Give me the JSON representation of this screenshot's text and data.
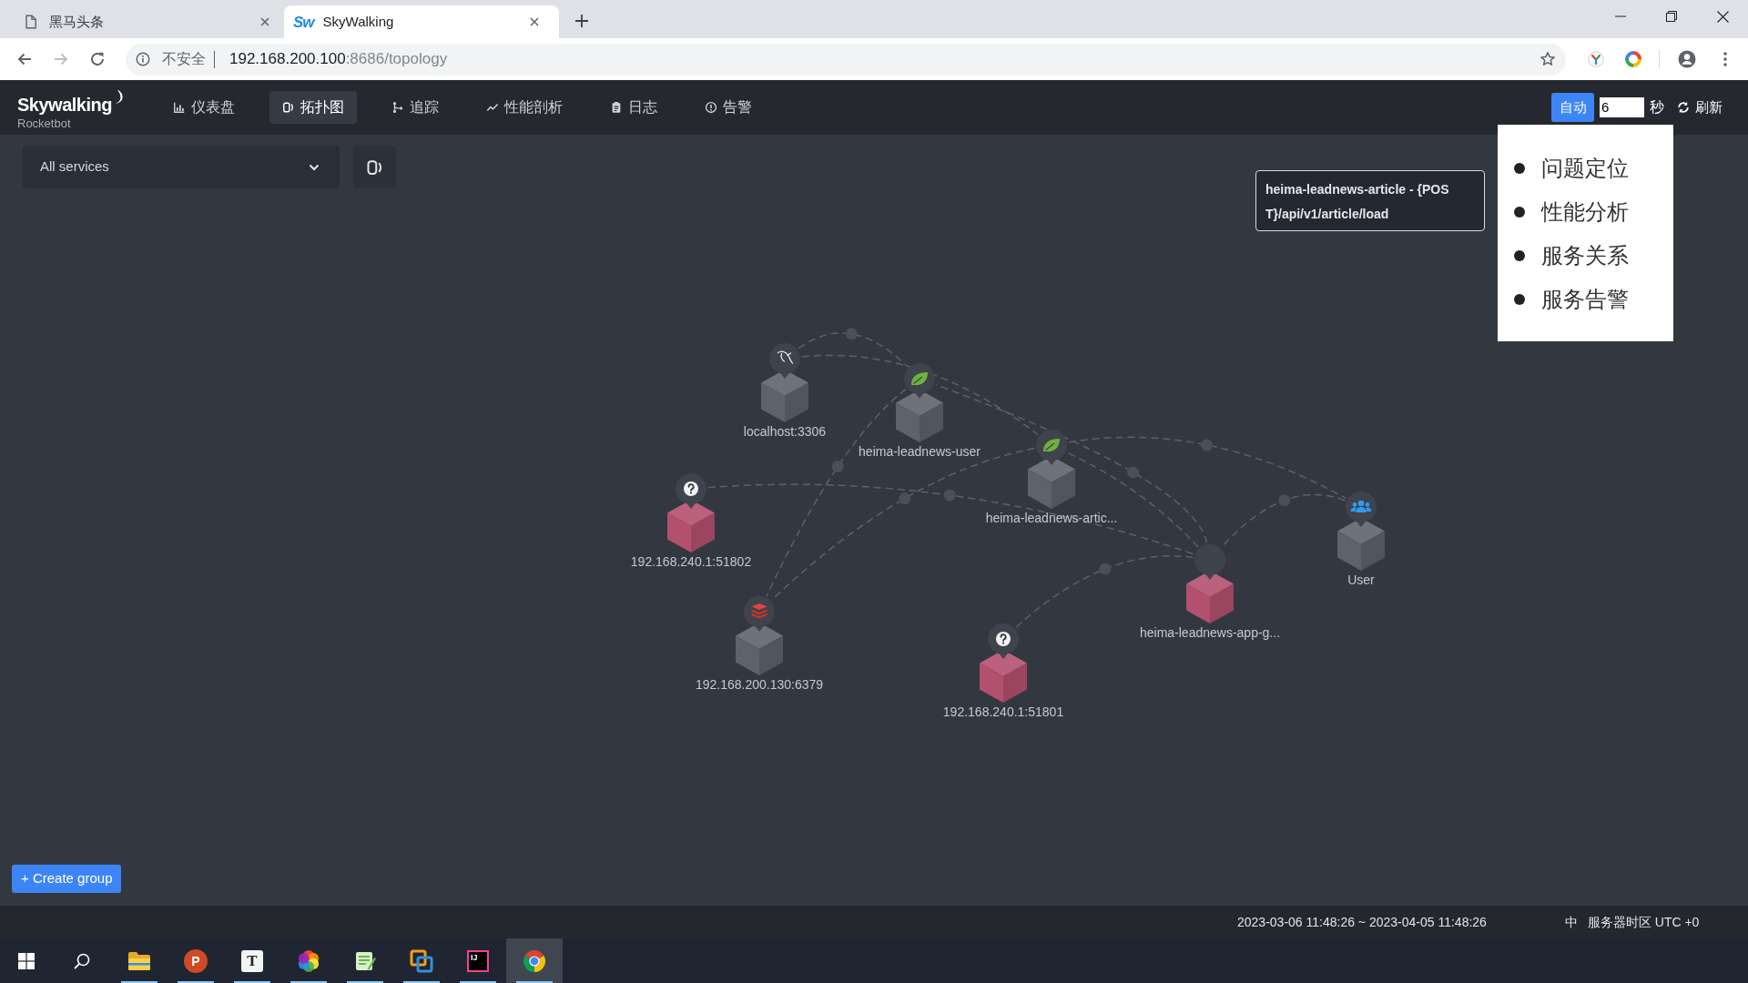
{
  "browser": {
    "tabs": [
      {
        "title": "黑马头条",
        "kind": "page",
        "selected": false
      },
      {
        "title": "SkyWalking",
        "kind": "app",
        "favicon": "Sw",
        "selected": true
      }
    ],
    "back_disabled": false,
    "forward_disabled": true,
    "address_bar": {
      "security": "不安全",
      "host": "192.168.200.100",
      "path": ":8686/topology"
    }
  },
  "app": {
    "logo": {
      "title": "Skywalking",
      "subtitle": "Rocketbot"
    },
    "nav": [
      {
        "label": "仪表盘",
        "kind": "dashboard",
        "selected": false
      },
      {
        "label": "拓扑图",
        "kind": "topology",
        "selected": true
      },
      {
        "label": "追踪",
        "kind": "trace",
        "selected": false
      },
      {
        "label": "性能剖析",
        "kind": "profile",
        "selected": false
      },
      {
        "label": "日志",
        "kind": "log",
        "selected": false
      },
      {
        "label": "告警",
        "kind": "alarm",
        "selected": false
      }
    ],
    "refresh": {
      "auto_label": "自动",
      "auto_on": true,
      "interval": "6",
      "unit": "秒",
      "refresh_label": "刷新"
    }
  },
  "toolbar": {
    "service_select": "All services"
  },
  "topology": {
    "nodes": [
      {
        "label": "localhost:3306",
        "kind": "mysql",
        "color": "#5e626b"
      },
      {
        "label": "heima-leadnews-user",
        "kind": "spring",
        "color": "#5e626b"
      },
      {
        "label": "heima-leadnews-artic...",
        "kind": "spring",
        "color": "#5e626b"
      },
      {
        "label": "192.168.240.1:51802",
        "kind": "unknown",
        "color": "#b4506f"
      },
      {
        "label": "User",
        "kind": "user",
        "color": "#5e626b"
      },
      {
        "label": "heima-leadnews-app-g...",
        "kind": "gateway",
        "color": "#b4506f"
      },
      {
        "label": "192.168.200.130:6379",
        "kind": "redis",
        "color": "#5e626b"
      },
      {
        "label": "192.168.240.1:51801",
        "kind": "unknown",
        "color": "#b4506f"
      }
    ]
  },
  "tooltip": {
    "text": "heima-leadnews-article - {POST}/api/v1/article/load"
  },
  "context_menu": {
    "items": [
      "问题定位",
      "性能分析",
      "服务关系",
      "服务告警"
    ]
  },
  "create_group": "+ Create group",
  "status_bar": {
    "time_range": "2023-03-06 11:48:26 ~ 2023-04-05 11:48:26",
    "language": "中",
    "timezone": "服务器时区 UTC +0"
  },
  "taskbar": {
    "apps": [
      {
        "kind": "folder",
        "running": true,
        "selected": false
      },
      {
        "kind": "slides",
        "glyph": "P",
        "running": true,
        "selected": false
      },
      {
        "kind": "editor",
        "glyph": "T",
        "running": true,
        "selected": false
      },
      {
        "kind": "color-wheel",
        "running": true,
        "selected": false
      },
      {
        "kind": "notepad",
        "running": true,
        "selected": false
      },
      {
        "kind": "squares",
        "running": true,
        "selected": false
      },
      {
        "kind": "ide",
        "glyph": "IJ",
        "running": true,
        "selected": false
      },
      {
        "kind": "browser",
        "running": true,
        "selected": true
      }
    ]
  }
}
